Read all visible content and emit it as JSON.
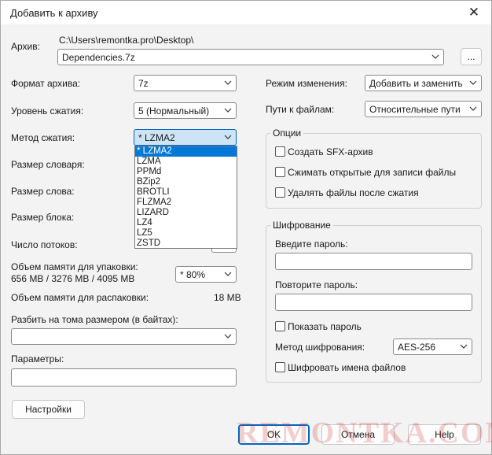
{
  "window": {
    "title": "Добавить к архиву",
    "close_glyph": "✕"
  },
  "archive": {
    "label": "Архив:",
    "path": "C:\\Users\\remontka.pro\\Desktop\\",
    "filename": "Dependencies.7z",
    "browse": "..."
  },
  "left": {
    "format_label": "Формат архива:",
    "format_value": "7z",
    "level_label": "Уровень сжатия:",
    "level_value": "5 (Нормальный)",
    "method_label": "Метод сжатия:",
    "method_value": "*  LZMA2",
    "dict_label": "Размер словаря:",
    "word_label": "Размер слова:",
    "block_label": "Размер блока:",
    "threads_label": "Число потоков:",
    "mem_pack_label": "Объем памяти для упаковки:",
    "mem_pack_values": "656 MB / 3276 MB / 4095 MB",
    "mem_pack_percent": "* 80%",
    "mem_unpack_label": "Объем памяти для распаковки:",
    "mem_unpack_value": "18 MB",
    "split_label": "Разбить на тома размером (в байтах):",
    "params_label": "Параметры:",
    "settings_button": "Настройки"
  },
  "method_dropdown": [
    "*  LZMA2",
    "LZMA",
    "PPMd",
    "BZip2",
    "BROTLI",
    "FLZMA2",
    "LIZARD",
    "LZ4",
    "LZ5",
    "ZSTD"
  ],
  "right": {
    "mode_label": "Режим изменения:",
    "mode_value": "Добавить и заменить",
    "paths_label": "Пути к файлам:",
    "paths_value": "Относительные пути",
    "options_title": "Опции",
    "opt_sfx": "Создать SFX-архив",
    "opt_shared": "Сжимать открытые для записи файлы",
    "opt_delete": "Удалять файлы после сжатия",
    "enc_title": "Шифрование",
    "enter_password": "Введите пароль:",
    "repeat_password": "Повторите пароль:",
    "show_password": "Показать пароль",
    "enc_method_label": "Метод шифрования:",
    "enc_method_value": "AES-256",
    "enc_names": "Шифровать имена файлов"
  },
  "footer": {
    "ok": "OK",
    "cancel": "Отмена",
    "help": "Help"
  },
  "watermark": "REMONTKA.COM"
}
